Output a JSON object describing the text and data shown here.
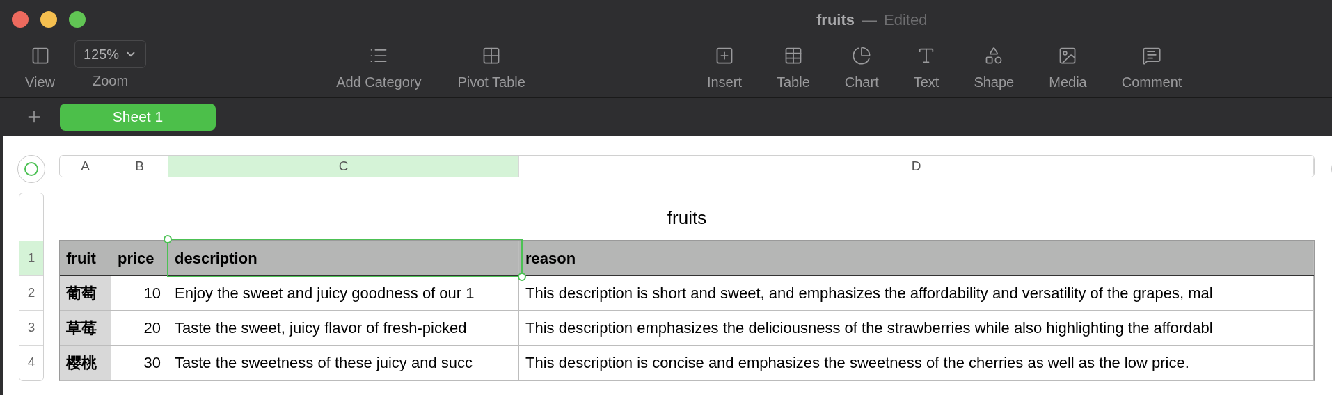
{
  "window": {
    "title": "fruits",
    "separator": "—",
    "status": "Edited"
  },
  "toolbar": {
    "left": [
      {
        "kind": "button",
        "label": "View"
      },
      {
        "kind": "zoom",
        "value": "125%",
        "label": "Zoom"
      }
    ],
    "middle": [
      {
        "kind": "button",
        "label": "Add Category"
      },
      {
        "kind": "button",
        "label": "Pivot Table"
      }
    ],
    "right": [
      {
        "kind": "button",
        "label": "Insert"
      },
      {
        "kind": "button",
        "label": "Table"
      },
      {
        "kind": "button",
        "label": "Chart"
      },
      {
        "kind": "button",
        "label": "Text"
      },
      {
        "kind": "button",
        "label": "Shape"
      },
      {
        "kind": "button",
        "label": "Media"
      },
      {
        "kind": "button",
        "label": "Comment"
      }
    ]
  },
  "sheet_tabs": [
    {
      "label": "Sheet 1",
      "selected": true
    }
  ],
  "column_headers": [
    {
      "label": "A",
      "selected": false
    },
    {
      "label": "B",
      "selected": false
    },
    {
      "label": "C",
      "selected": true
    },
    {
      "label": "D",
      "selected": false
    }
  ],
  "table": {
    "title": "fruits",
    "rows": [
      {
        "number": "1",
        "selected": true,
        "kind": "header",
        "cells": [
          {
            "text": "fruit",
            "selected": false
          },
          {
            "text": "price",
            "selected": false
          },
          {
            "text": "description",
            "selected": true
          },
          {
            "text": "reason",
            "selected": false
          }
        ]
      },
      {
        "number": "2",
        "selected": false,
        "kind": "body",
        "cells": [
          {
            "text": "葡萄",
            "selected": false
          },
          {
            "text": "10",
            "selected": false
          },
          {
            "text": "Enjoy the sweet and juicy goodness of our 1",
            "selected": false
          },
          {
            "text": "This description is short and sweet, and emphasizes the affordability and versatility of the grapes, mal",
            "selected": false
          }
        ]
      },
      {
        "number": "3",
        "selected": false,
        "kind": "body",
        "cells": [
          {
            "text": "草莓",
            "selected": false
          },
          {
            "text": "20",
            "selected": false
          },
          {
            "text": "Taste the sweet, juicy flavor of fresh-picked",
            "selected": false
          },
          {
            "text": "This description emphasizes the deliciousness of the strawberries while also highlighting the affordabl",
            "selected": false
          }
        ]
      },
      {
        "number": "4",
        "selected": false,
        "kind": "body",
        "cells": [
          {
            "text": "樱桃",
            "selected": false
          },
          {
            "text": "30",
            "selected": false
          },
          {
            "text": "Taste the sweetness of these juicy and succ",
            "selected": false
          },
          {
            "text": "This description is concise and emphasizes the sweetness of the cherries as well as the low price.",
            "selected": false
          }
        ]
      }
    ]
  }
}
